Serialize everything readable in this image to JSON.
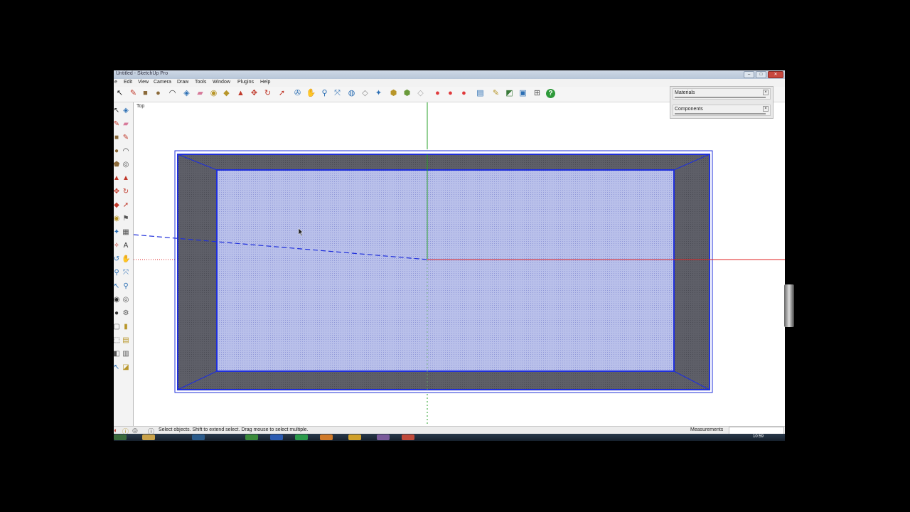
{
  "window": {
    "title": "Untitled - SketchUp Pro",
    "controls": {
      "minimize": "–",
      "maximize": "□",
      "close": "✕"
    }
  },
  "menu": [
    {
      "label": "File",
      "shown": "e"
    },
    {
      "label": "Edit"
    },
    {
      "label": "View"
    },
    {
      "label": "Camera"
    },
    {
      "label": "Draw"
    },
    {
      "label": "Tools"
    },
    {
      "label": "Window"
    },
    {
      "label": "Plugins"
    },
    {
      "label": "Help"
    }
  ],
  "toolbar": {
    "tools": [
      {
        "name": "select-tool",
        "glyph": "↖",
        "color": "#222222"
      },
      {
        "name": "line-tool",
        "glyph": "✎",
        "color": "#c0392b"
      },
      {
        "name": "rectangle-tool",
        "glyph": "■",
        "color": "#8b6a3a"
      },
      {
        "name": "circle-tool",
        "glyph": "●",
        "color": "#8b6a3a"
      },
      {
        "name": "arc-tool",
        "glyph": "◠",
        "color": "#333333"
      },
      {
        "name": "make-component-tool",
        "glyph": "◈",
        "color": "#2c6fb4"
      },
      {
        "name": "eraser-tool",
        "glyph": "▰",
        "color": "#d77a9a"
      },
      {
        "name": "tape-measure-tool",
        "glyph": "◉",
        "color": "#b8962a"
      },
      {
        "name": "paint-bucket-tool",
        "glyph": "◆",
        "color": "#b8962a"
      },
      {
        "name": "push-pull-tool",
        "glyph": "▲",
        "color": "#c0392b"
      },
      {
        "name": "move-tool",
        "glyph": "✥",
        "color": "#c0392b"
      },
      {
        "name": "rotate-tool",
        "glyph": "↻",
        "color": "#c0392b"
      },
      {
        "name": "follow-me-tool",
        "glyph": "➚",
        "color": "#c0392b"
      },
      {
        "name": "orbit-tool",
        "glyph": "✇",
        "color": "#2c6fb4"
      },
      {
        "name": "pan-tool",
        "glyph": "✋",
        "color": "#555555"
      },
      {
        "name": "zoom-tool",
        "glyph": "⚲",
        "color": "#2c6fb4"
      },
      {
        "name": "zoom-extents-tool",
        "glyph": "⤧",
        "color": "#2c6fb4"
      },
      {
        "name": "get-models-tool",
        "glyph": "◍",
        "color": "#2c6fb4"
      },
      {
        "name": "share-model-tool",
        "glyph": "◇",
        "color": "#888888"
      },
      {
        "name": "get-photo-texture-tool",
        "glyph": "✦",
        "color": "#2c6fb4"
      },
      {
        "name": "warehouse-tool",
        "glyph": "⬢",
        "color": "#b8962a"
      },
      {
        "name": "photo-textures-tool",
        "glyph": "⬢",
        "color": "#6a9a3a"
      },
      {
        "name": "extension-tool",
        "glyph": "◇",
        "color": "#aaaaaa"
      },
      {
        "name": "record-red-1",
        "glyph": "●",
        "color": "#e0393b"
      },
      {
        "name": "record-red-2",
        "glyph": "●",
        "color": "#e0393b"
      },
      {
        "name": "record-red-3",
        "glyph": "●",
        "color": "#e0393b"
      },
      {
        "name": "layout-tool",
        "glyph": "▤",
        "color": "#2c6fb4"
      },
      {
        "name": "style-tool",
        "glyph": "✎",
        "color": "#b8962a"
      },
      {
        "name": "scene-tool",
        "glyph": "◩",
        "color": "#3a7a3a"
      },
      {
        "name": "section-tool",
        "glyph": "▣",
        "color": "#2c6fb4"
      },
      {
        "name": "settings-tool",
        "glyph": "⊞",
        "color": "#555555"
      },
      {
        "name": "help-tool",
        "glyph": "?",
        "color": "#ffffff",
        "bg": "#2e9a3a"
      }
    ]
  },
  "left_toolbar": [
    [
      "↖",
      "#222222",
      "◈",
      "#2c6fb4"
    ],
    [
      "✎",
      "#c0392b",
      "▰",
      "#d77a9a"
    ],
    [
      "■",
      "#8b6a3a",
      "✎",
      "#c0392b"
    ],
    [
      "●",
      "#8b6a3a",
      "◠",
      "#333333"
    ],
    [
      "⬟",
      "#8b6a3a",
      "◎",
      "#555555"
    ],
    [
      "▲",
      "#c0392b",
      "▲",
      "#c0392b"
    ],
    [
      "✥",
      "#c0392b",
      "↻",
      "#c0392b"
    ],
    [
      "◆",
      "#c0392b",
      "➚",
      "#c0392b"
    ],
    [
      "◉",
      "#b8962a",
      "⚑",
      "#555555"
    ],
    [
      "✦",
      "#2c6fb4",
      "▦",
      "#555555"
    ],
    [
      "✧",
      "#c0392b",
      "A",
      "#333333"
    ],
    [
      "↺",
      "#2c6fb4",
      "✋",
      "#555555"
    ],
    [
      "⚲",
      "#2c6fb4",
      "⤧",
      "#2c6fb4"
    ],
    [
      "↖",
      "#2c6fb4",
      "⚲",
      "#2c6fb4"
    ],
    [
      "◉",
      "#333333",
      "◎",
      "#555555"
    ],
    [
      "●",
      "#333333",
      "⚙",
      "#555555"
    ],
    [
      "▢",
      "#555555",
      "▮",
      "#b8962a"
    ],
    [
      "⬚",
      "#555555",
      "▤",
      "#b8962a"
    ],
    [
      "◧",
      "#555555",
      "▥",
      "#555555"
    ],
    [
      "↖",
      "#2c6fb4",
      "◪",
      "#b8962a"
    ]
  ],
  "viewport": {
    "view_label": "Top"
  },
  "colors": {
    "red_axis": "#e02020",
    "green_axis": "#2aa02a",
    "blue_edge": "#1f2fdb",
    "dark_face": "#5d5e67",
    "light_face": "#b8bfe8"
  },
  "trays": {
    "materials": "Materials",
    "components": "Components"
  },
  "status": {
    "message": "Select objects. Shift to extend select. Drag mouse to select multiple.",
    "measurements_label": "Measurements",
    "measurements_value": ""
  },
  "taskbar": {
    "clock": "10:59"
  }
}
